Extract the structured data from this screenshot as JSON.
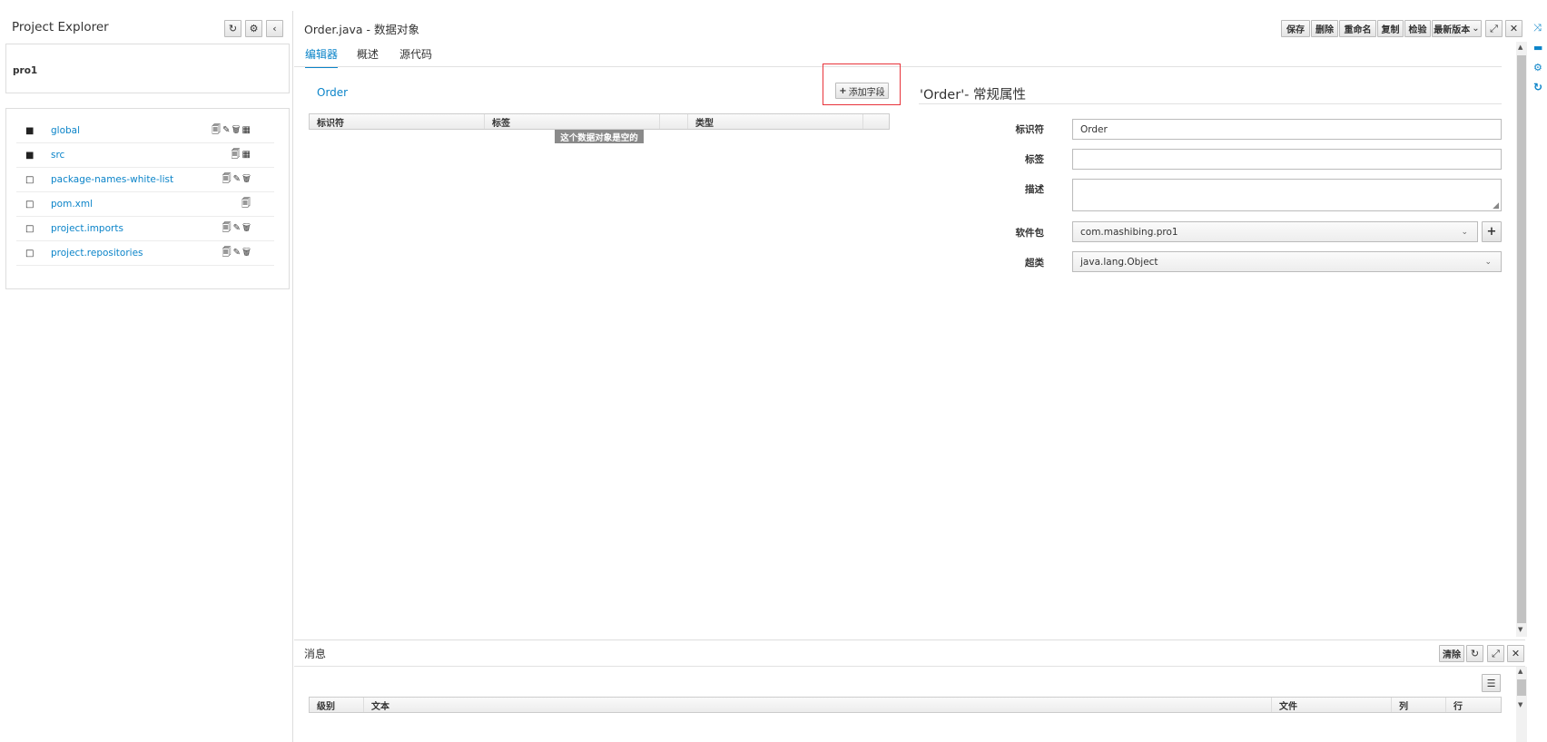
{
  "explorer": {
    "title": "Project Explorer",
    "refresh_icon": "refresh-icon",
    "gear_icon": "gear-icon",
    "collapse_icon": "chevron-left-icon",
    "project_name": "pro1",
    "items": [
      {
        "name": "global",
        "type": "folder",
        "actions": "🗐✎🗑▦"
      },
      {
        "name": "src",
        "type": "folder",
        "actions": "🗐▦"
      },
      {
        "name": "package-names-white-list",
        "type": "file",
        "actions": "🗐✎🗑"
      },
      {
        "name": "pom.xml",
        "type": "file",
        "actions": "🗐"
      },
      {
        "name": "project.imports",
        "type": "file",
        "actions": "🗐✎🗑"
      },
      {
        "name": "project.repositories",
        "type": "file",
        "actions": "🗐✎🗑"
      }
    ]
  },
  "editor": {
    "title": "Order.java - 数据对象",
    "toolbar": {
      "save": "保存",
      "delete": "删除",
      "rename": "重命名",
      "copy": "复制",
      "validate": "检验",
      "latest_version": "最新版本",
      "maximize_icon": "expand-icon",
      "close_icon": "close-icon"
    },
    "tabs": [
      "编辑器",
      "概述",
      "源代码"
    ],
    "active_tab": 0,
    "object_name": "Order",
    "add_field_button": "添加字段",
    "table_headers": [
      "标识符",
      "标签",
      "",
      "类型"
    ],
    "empty_message": "这个数据对象是空的",
    "properties_title": "'Order'- 常规属性",
    "properties": {
      "identifier_label": "标识符",
      "identifier_value": "Order",
      "label_label": "标签",
      "label_value": "",
      "description_label": "描述",
      "description_value": "",
      "package_label": "软件包",
      "package_value": "com.mashibing.pro1",
      "superclass_label": "超类",
      "superclass_value": "java.lang.Object"
    }
  },
  "messages": {
    "title": "消息",
    "clear_button": "清除",
    "headers": [
      "级别",
      "文本",
      "文件",
      "列",
      "行"
    ]
  },
  "colors": {
    "accent": "#0b84c9",
    "highlight_box": "#e8333a"
  }
}
